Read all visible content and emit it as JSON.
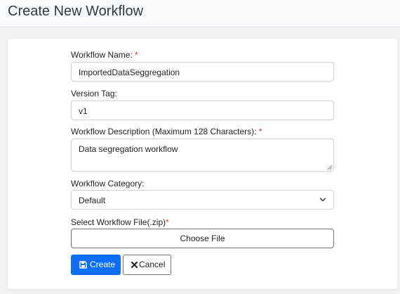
{
  "header": {
    "title": "Create New Workflow"
  },
  "form": {
    "name": {
      "label": "Workflow Name: ",
      "required_mark": "*",
      "value": "ImportedDataSeggregation"
    },
    "version": {
      "label": "Version Tag:",
      "value": "v1"
    },
    "description": {
      "label": "Workflow Description (Maximum 128 Characters): ",
      "required_mark": "*",
      "value": "Data segregation workflow"
    },
    "category": {
      "label": "Workflow Category:",
      "selected": "Default"
    },
    "file": {
      "label": "Select Workflow File(.zip)",
      "required_mark": "*",
      "button_label": "Choose File"
    }
  },
  "actions": {
    "create_label": "Create",
    "cancel_label": "Cancel"
  },
  "colors": {
    "primary": "#0d6efd",
    "required": "#dc3545"
  },
  "icons": {
    "create": "save-icon",
    "cancel": "close-icon",
    "select": "chevron-down-icon"
  }
}
